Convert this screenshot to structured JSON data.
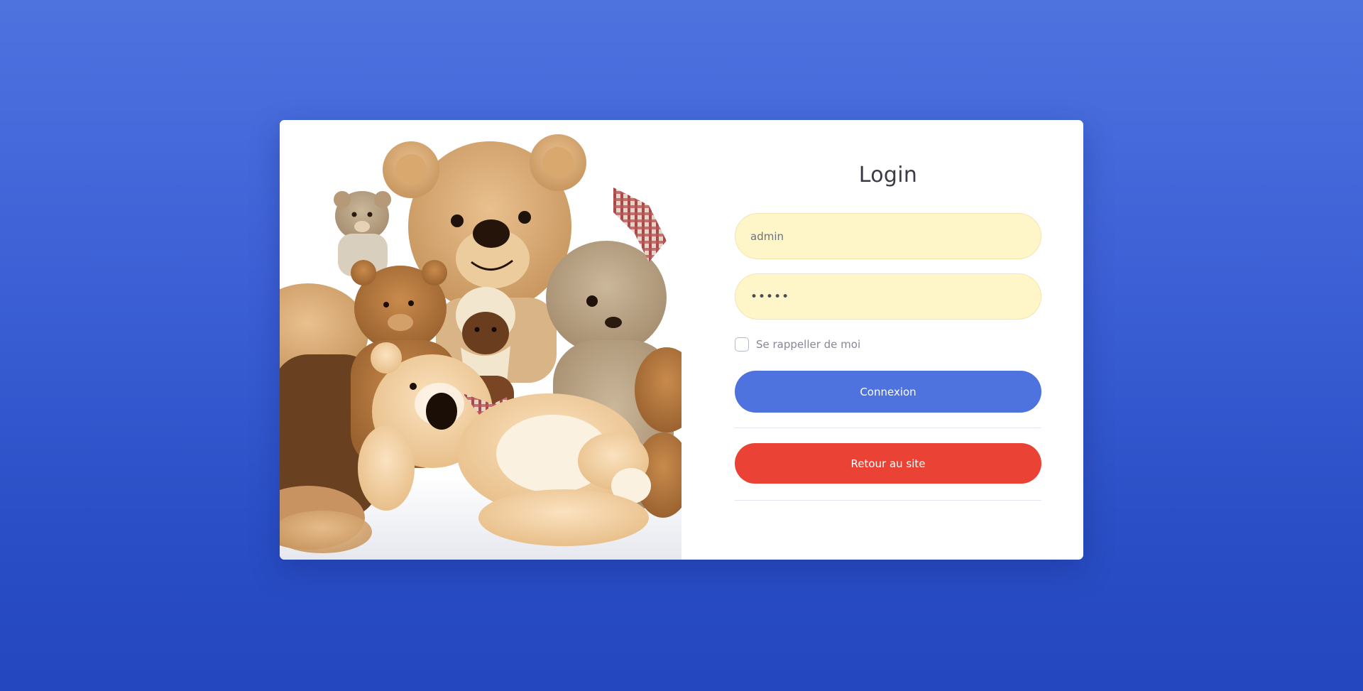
{
  "image": {
    "alt_icon": "teddy-bears-photo"
  },
  "login": {
    "title": "Login",
    "username_value": "admin",
    "password_value": "•••••",
    "remember_label": "Se rappeller de moi",
    "remember_checked": false,
    "login_button": "Connexion",
    "back_button": "Retour au site"
  },
  "colors": {
    "background_top": "#4e73df",
    "background_bottom": "#2446be",
    "login_button": "#4e73df",
    "back_button": "#ea4335",
    "input_bg": "#fef5c8"
  }
}
